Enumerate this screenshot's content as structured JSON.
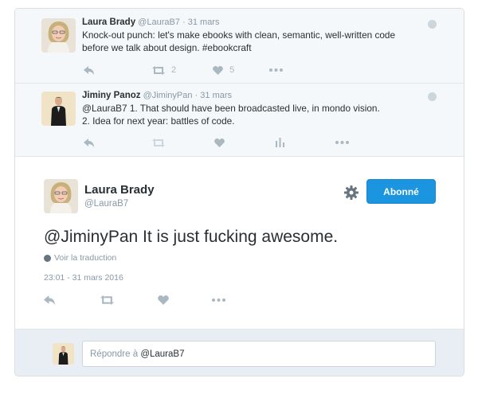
{
  "tweet1": {
    "fullname": "Laura Brady",
    "handle": "@LauraB7",
    "sep": "·",
    "date": "31 mars",
    "text_line1": "Knock-out punch: let's make ebooks with clean, semantic, well-written code",
    "text_line2": "before we talk about design. #ebookcraft",
    "retweets": "2",
    "likes": "5"
  },
  "tweet2": {
    "fullname": "Jiminy Panoz",
    "handle": "@JiminyPan",
    "sep": "·",
    "date": "31 mars",
    "text_line1": "@LauraB7 1. That should have been broadcasted live, in mondo vision.",
    "text_line2": "2. Idea for next year: battles of code."
  },
  "main_tweet": {
    "fullname": "Laura Brady",
    "handle": "@LauraB7",
    "follow_label": "Abonné",
    "text": "@JiminyPan It is just fucking awesome.",
    "translate_label": "Voir la traduction",
    "timestamp": "23:01 - 31 mars 2016"
  },
  "reply": {
    "prefix": "Répondre à",
    "mention": "@LauraB7"
  },
  "icons": {
    "reply": "reply-icon",
    "retweet": "retweet-icon",
    "like": "heart-icon",
    "more": "more-icon",
    "analytics": "analytics-icon",
    "gear": "gear-icon",
    "globe": "globe-icon"
  },
  "colors": {
    "accent": "#1b95e0",
    "muted": "#8899a6",
    "icon": "#aab8c2",
    "text": "#292f33",
    "context_bg": "#f5f8fa",
    "reply_bg": "#e8eef3"
  }
}
